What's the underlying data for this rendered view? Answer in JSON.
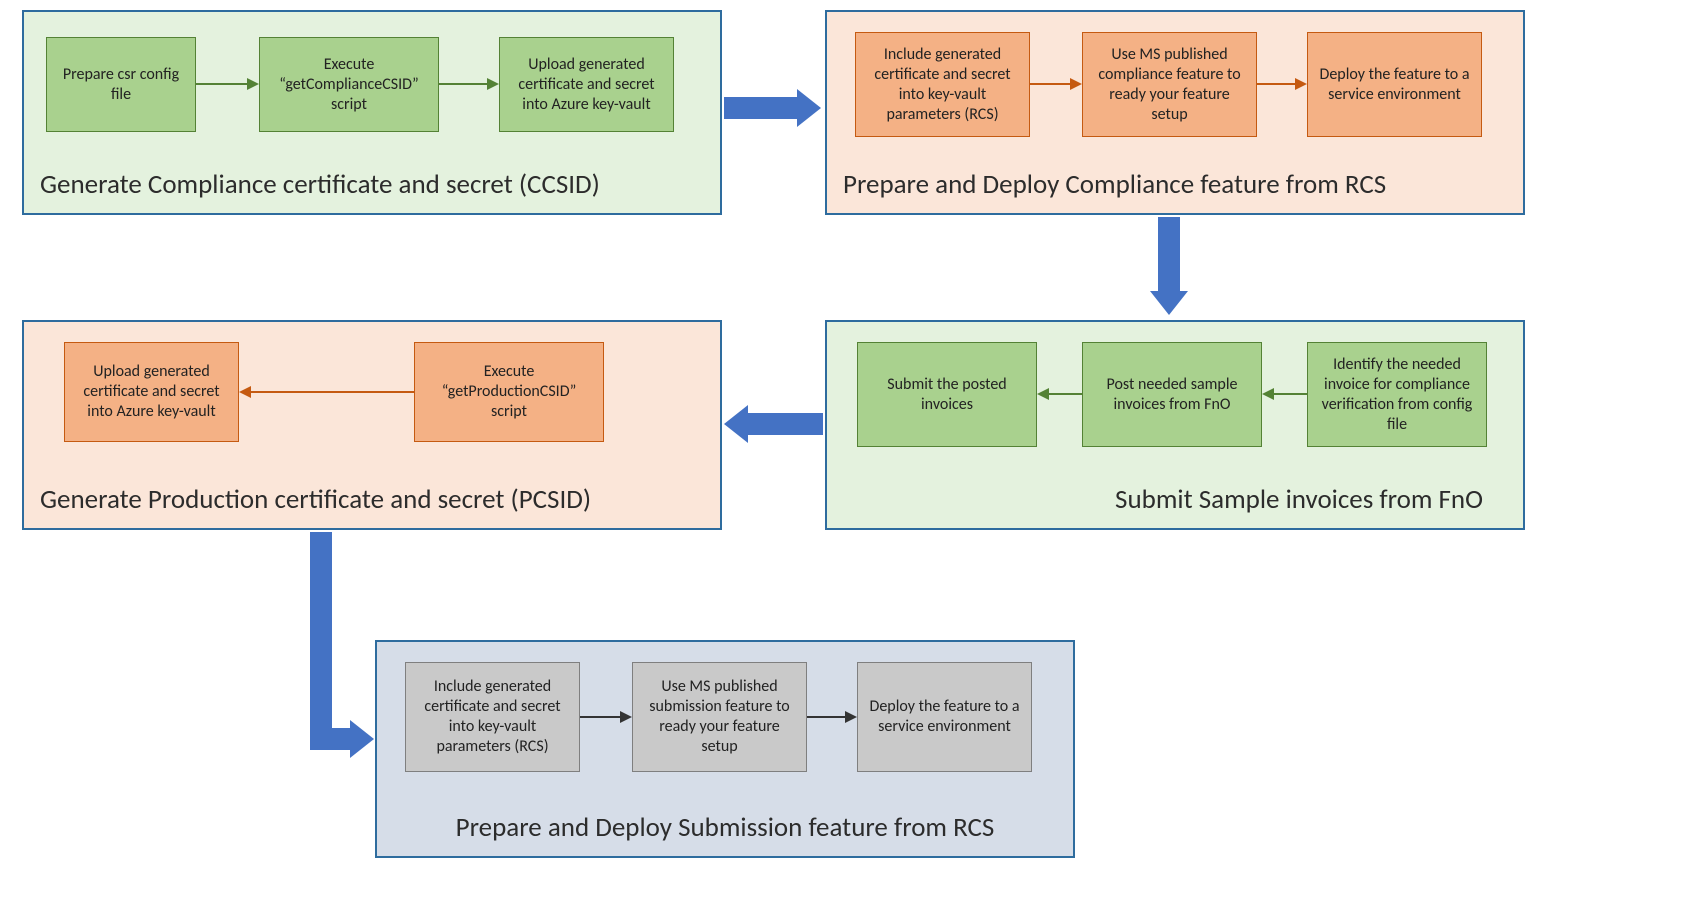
{
  "stages": {
    "ccsid": {
      "title": "Generate Compliance certificate and secret (CCSID)",
      "steps": [
        "Prepare csr config file",
        "Execute “getComplianceCSID” script",
        "Upload generated certificate and secret into Azure key-vault"
      ]
    },
    "compliance_feature": {
      "title": "Prepare and Deploy Compliance feature from RCS",
      "steps": [
        "Include generated certificate and secret into key-vault parameters (RCS)",
        "Use MS published compliance feature to ready your feature setup",
        "Deploy the feature to a service environment"
      ]
    },
    "submit": {
      "title": "Submit Sample invoices from FnO",
      "steps": [
        "Identify the needed invoice for compliance verification from config file",
        "Post needed sample invoices from FnO",
        "Submit the posted invoices"
      ]
    },
    "pcsid": {
      "title": "Generate Production certificate and secret (PCSID)",
      "steps": [
        "Execute “getProductionCSID” script",
        "Upload generated certificate and secret into Azure key-vault"
      ]
    },
    "submission_feature": {
      "title": "Prepare and Deploy Submission feature from RCS",
      "steps": [
        "Include generated certificate and secret into key-vault parameters (RCS)",
        "Use MS published submission feature to ready your feature setup",
        "Deploy the feature to a service environment"
      ]
    }
  }
}
